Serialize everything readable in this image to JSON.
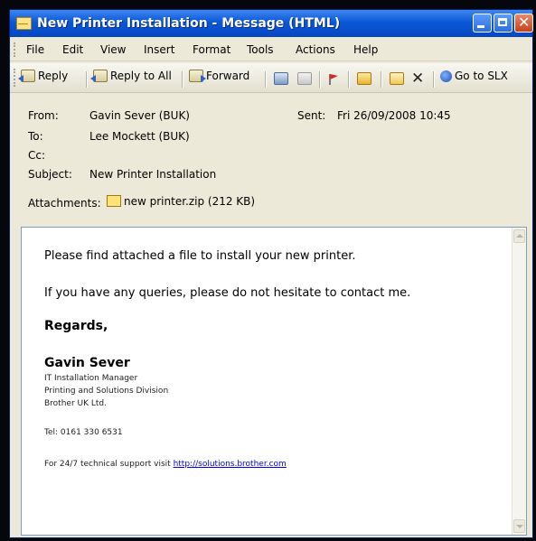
{
  "window": {
    "title": "New Printer Installation - Message (HTML)"
  },
  "menu": [
    "File",
    "Edit",
    "View",
    "Insert",
    "Format",
    "Tools",
    "Actions",
    "Help"
  ],
  "toolbar": {
    "reply": "Reply",
    "reply_all": "Reply to All",
    "forward": "Forward",
    "go_to_slx": "Go to SLX"
  },
  "header": {
    "from_label": "From:",
    "from": "Gavin Sever (BUK)",
    "sent_label": "Sent:",
    "sent": "Fri 26/09/2008 10:45",
    "to_label": "To:",
    "to": "Lee Mockett (BUK)",
    "cc_label": "Cc:",
    "cc": "",
    "subject_label": "Subject:",
    "subject": "New Printer Installation",
    "attachments_label": "Attachments:",
    "attachment_name": "new printer.zip (212 KB)"
  },
  "body": {
    "line1": "Please find attached a file to install your new printer.",
    "line2": "If you have any queries, please do not hesitate to contact me.",
    "regards": "Regards,",
    "sig_name": "Gavin Sever",
    "sig_title": "IT Installation Manager",
    "sig_division": "Printing and Solutions Division",
    "sig_company": "Brother UK Ltd.",
    "sig_tel": "Tel: 0161 330 6531",
    "support_text": "For 24/7 technical support visit",
    "support_link": "http://solutions.brother.com"
  },
  "colors": {
    "titlebar": "#0a58d8",
    "window_bg": "#ece9d8",
    "link": "#0000ee"
  }
}
